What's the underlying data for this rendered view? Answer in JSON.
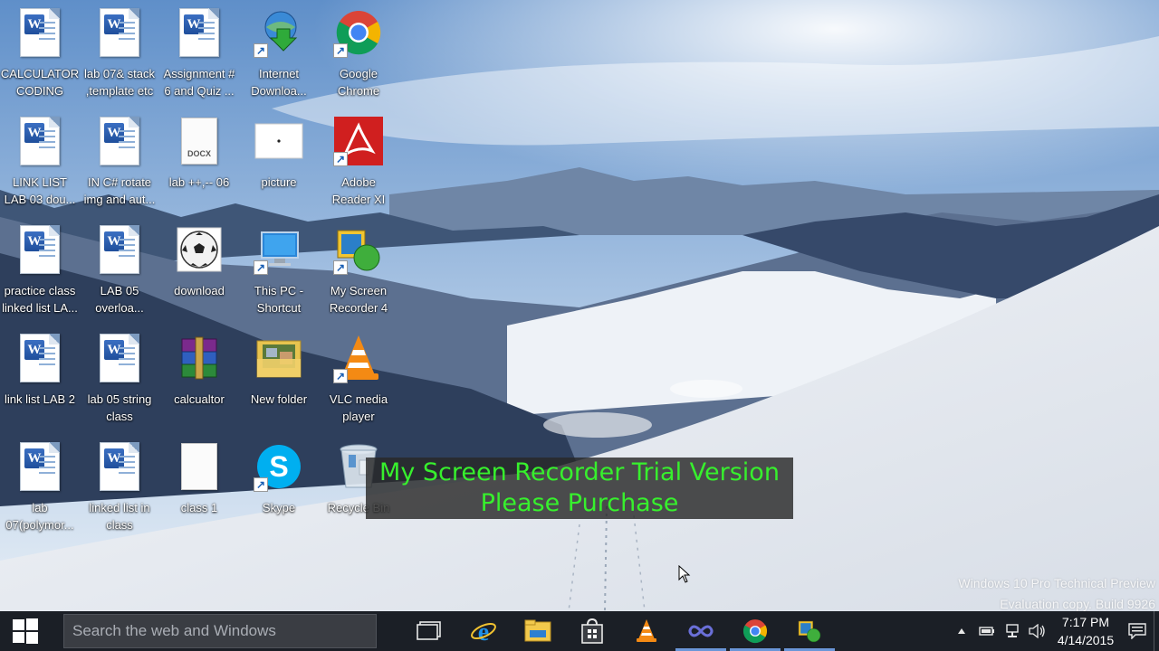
{
  "desktop": {
    "icons": [
      {
        "label": "CALCULATOR\nCODING",
        "icon": "word-document-icon"
      },
      {
        "label": "lab 07& stack\n,template etc",
        "icon": "word-document-icon"
      },
      {
        "label": "Assignment #\n6 and Quiz ...",
        "icon": "word-document-icon"
      },
      {
        "label": "Internet\nDownloa...",
        "icon": "internet-download-manager-icon"
      },
      {
        "label": "Google\nChrome",
        "icon": "chrome-icon"
      },
      {
        "label": "LINK LIST\nLAB 03 dou...",
        "icon": "word-document-icon"
      },
      {
        "label": "IN C# rotate\nimg and aut...",
        "icon": "word-document-icon"
      },
      {
        "label": "lab ++,-- 06",
        "icon": "docx-file-icon",
        "tag": "DOCX"
      },
      {
        "label": "picture",
        "icon": "image-file-icon"
      },
      {
        "label": "Adobe\nReader XI",
        "icon": "adobe-reader-icon"
      },
      {
        "label": "practice class\nlinked list LA...",
        "icon": "word-document-icon"
      },
      {
        "label": "LAB 05\noverloa...",
        "icon": "word-document-icon"
      },
      {
        "label": "download",
        "icon": "soccer-ball-icon"
      },
      {
        "label": "This PC -\nShortcut",
        "icon": "this-pc-icon"
      },
      {
        "label": "My Screen\nRecorder 4",
        "icon": "screen-recorder-icon"
      },
      {
        "label": "link list LAB 2",
        "icon": "word-document-icon"
      },
      {
        "label": "lab 05 string\nclass",
        "icon": "word-document-icon"
      },
      {
        "label": "calcualtor",
        "icon": "winrar-archive-icon"
      },
      {
        "label": "New folder",
        "icon": "folder-icon"
      },
      {
        "label": "VLC media\nplayer",
        "icon": "vlc-icon"
      },
      {
        "label": "lab\n07(polymor...",
        "icon": "word-document-icon"
      },
      {
        "label": "linked list in\nclass",
        "icon": "word-document-icon"
      },
      {
        "label": "class 1",
        "icon": "blank-file-icon"
      },
      {
        "label": "Skype",
        "icon": "skype-icon"
      },
      {
        "label": "Recycle Bin",
        "icon": "recycle-bin-icon"
      }
    ]
  },
  "overlay": {
    "line1": "My Screen Recorder Trial Version",
    "line2": "Please Purchase"
  },
  "watermark": {
    "line1": "Windows 10 Pro Technical Preview",
    "line2": "Evaluation copy. Build 9926"
  },
  "taskbar": {
    "search_placeholder": "Search the web and Windows",
    "apps": [
      {
        "name": "task-view-icon"
      },
      {
        "name": "internet-explorer-icon"
      },
      {
        "name": "file-explorer-icon"
      },
      {
        "name": "store-icon"
      },
      {
        "name": "vlc-icon"
      },
      {
        "name": "infinity-app-icon"
      },
      {
        "name": "chrome-icon"
      },
      {
        "name": "screen-recorder-icon"
      }
    ],
    "clock": {
      "time": "7:17 PM",
      "date": "4/14/2015"
    }
  },
  "colors": {
    "taskbar": "#1b1f26",
    "overlay_text": "#37f02d",
    "active_indicator": "#6a96d8"
  }
}
